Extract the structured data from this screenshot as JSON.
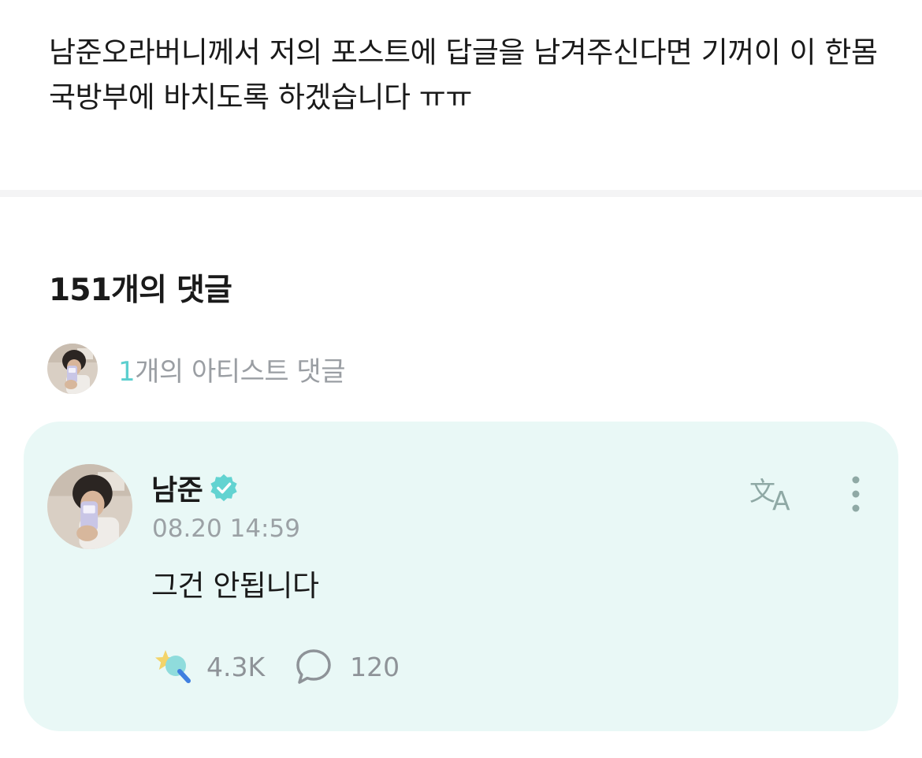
{
  "post": {
    "body_text": "남준오라버니께서 저의 포스트에 답글을 남겨주신다면 기꺼이 이 한몸 국방부에 바치도록 하겠습니다 ㅠㅠ"
  },
  "comments_section": {
    "heading": "151개의 댓글",
    "artist_summary": {
      "count": "1",
      "label": "개의 아티스트 댓글"
    }
  },
  "artist_comment": {
    "author": "남준",
    "timestamp": "08.20 14:59",
    "text": "그건 안됩니다",
    "like_count": "4.3K",
    "reply_count": "120"
  },
  "colors": {
    "accent": "#5ccfcf",
    "card_background": "#e9f8f6",
    "muted_text": "#9ba1a5"
  },
  "icons": {
    "verified": "verified-badge-icon",
    "translate": "translate-icon",
    "more": "more-vertical-icon",
    "like": "star-wand-icon",
    "reply": "speech-bubble-icon"
  }
}
